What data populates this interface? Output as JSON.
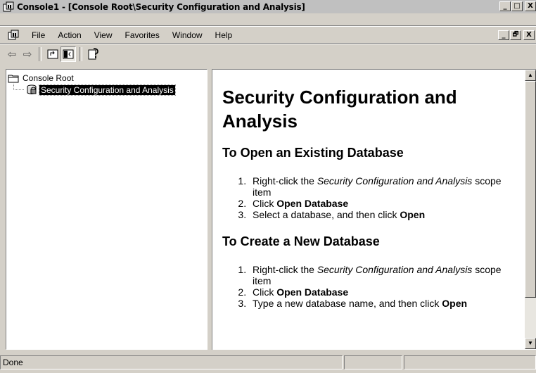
{
  "window": {
    "title": "Console1 - [Console Root\\Security Configuration and Analysis]",
    "buttons": {
      "minimize": "_",
      "restore": "□",
      "close": "X"
    }
  },
  "menubar": {
    "items": [
      "File",
      "Action",
      "View",
      "Favorites",
      "Window",
      "Help"
    ],
    "mdi_buttons": {
      "minimize": "_",
      "restore": "🗗",
      "close": "X"
    }
  },
  "toolbar": {
    "buttons": [
      {
        "icon": "back-arrow-icon",
        "glyph": "⇦"
      },
      {
        "icon": "forward-arrow-icon",
        "glyph": "⇨"
      },
      {
        "icon": "up-one-level-icon",
        "glyph": "⮤"
      },
      {
        "icon": "show-hide-tree-icon",
        "glyph": "◨"
      },
      {
        "icon": "help-icon",
        "glyph": "?"
      }
    ]
  },
  "tree": {
    "root": "Console Root",
    "items": [
      "Security Configuration and Analysis"
    ]
  },
  "detail": {
    "title": "Security Configuration and Analysis",
    "sections": [
      {
        "heading": "To Open an Existing Database",
        "steps": [
          [
            "Right-click the ",
            "Security Configuration and Analysis",
            " scope item"
          ],
          [
            "Click ",
            "Open Database",
            ""
          ],
          [
            "Select a database, and then click ",
            "Open",
            ""
          ]
        ]
      },
      {
        "heading": "To Create a New Database",
        "steps": [
          [
            "Right-click the ",
            "Security Configuration and Analysis",
            " scope item"
          ],
          [
            "Click ",
            "Open Database",
            ""
          ],
          [
            "Type a new database name, and then click ",
            "Open",
            ""
          ]
        ]
      }
    ]
  },
  "statusbar": {
    "text": "Done"
  }
}
